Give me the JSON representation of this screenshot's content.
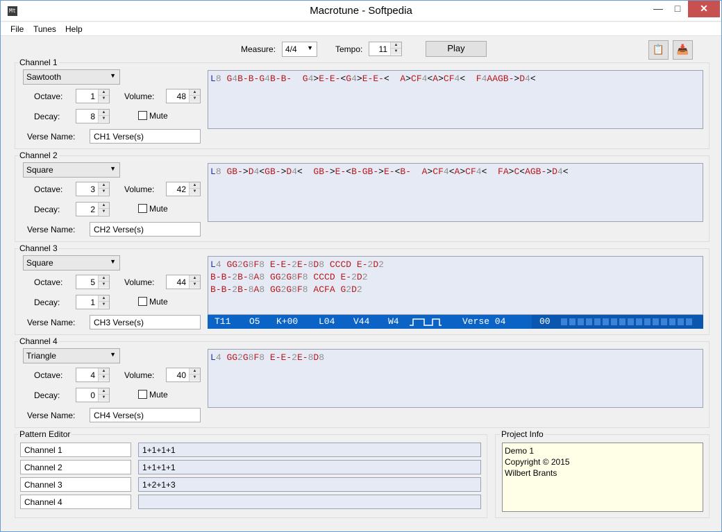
{
  "window": {
    "title": "Macrotune - Softpedia",
    "app_icon": "Mt"
  },
  "menu": [
    "File",
    "Tunes",
    "Help"
  ],
  "toolbar": {
    "measure_label": "Measure:",
    "measure_value": "4/4",
    "tempo_label": "Tempo:",
    "tempo_value": "11",
    "play_label": "Play"
  },
  "labels": {
    "octave": "Octave:",
    "volume": "Volume:",
    "decay": "Decay:",
    "mute": "Mute",
    "verse_name": "Verse Name:"
  },
  "channels": [
    {
      "title": "Channel 1",
      "wave": "Sawtooth",
      "octave": "1",
      "volume": "48",
      "decay": "8",
      "verse": "CH1 Verse(s)"
    },
    {
      "title": "Channel 2",
      "wave": "Square",
      "octave": "3",
      "volume": "42",
      "decay": "2",
      "verse": "CH2 Verse(s)"
    },
    {
      "title": "Channel 3",
      "wave": "Square",
      "octave": "5",
      "volume": "44",
      "decay": "1",
      "verse": "CH3 Verse(s)"
    },
    {
      "title": "Channel 4",
      "wave": "Triangle",
      "octave": "4",
      "volume": "40",
      "decay": "0",
      "verse": "CH4 Verse(s)"
    }
  ],
  "editors": {
    "ch1": [
      [
        [
          "L",
          "b"
        ],
        [
          "8",
          "g"
        ],
        [
          " ",
          "k"
        ],
        [
          "G",
          "r"
        ],
        [
          "4",
          "g"
        ],
        [
          "B",
          "r"
        ],
        [
          "-",
          "r"
        ],
        [
          "B",
          "r"
        ],
        [
          "-",
          "r"
        ],
        [
          "G",
          "r"
        ],
        [
          "4",
          "g"
        ],
        [
          "B",
          "r"
        ],
        [
          "-",
          "r"
        ],
        [
          "B",
          "r"
        ],
        [
          "-",
          "r"
        ],
        [
          "  ",
          "k"
        ],
        [
          "G",
          "r"
        ],
        [
          "4",
          "g"
        ],
        [
          ">",
          "k"
        ],
        [
          "E",
          "r"
        ],
        [
          "-",
          "r"
        ],
        [
          "E",
          "r"
        ],
        [
          "-",
          "r"
        ],
        [
          "<",
          "k"
        ],
        [
          "G",
          "r"
        ],
        [
          "4",
          "g"
        ],
        [
          ">",
          "k"
        ],
        [
          "E",
          "r"
        ],
        [
          "-",
          "r"
        ],
        [
          "E",
          "r"
        ],
        [
          "-",
          "r"
        ],
        [
          "<",
          "k"
        ],
        [
          "  ",
          "k"
        ],
        [
          "A",
          "r"
        ],
        [
          ">",
          "k"
        ],
        [
          "C",
          "r"
        ],
        [
          "F",
          "r"
        ],
        [
          "4",
          "g"
        ],
        [
          "<",
          "k"
        ],
        [
          "A",
          "r"
        ],
        [
          ">",
          "k"
        ],
        [
          "C",
          "r"
        ],
        [
          "F",
          "r"
        ],
        [
          "4",
          "g"
        ],
        [
          "<",
          "k"
        ],
        [
          "  ",
          "k"
        ],
        [
          "F",
          "r"
        ],
        [
          "4",
          "g"
        ],
        [
          "AAGB",
          "r"
        ],
        [
          "-",
          "r"
        ],
        [
          ">",
          "k"
        ],
        [
          "D",
          "r"
        ],
        [
          "4",
          "g"
        ],
        [
          "<",
          "k"
        ]
      ]
    ],
    "ch2": [
      [
        [
          "L",
          "b"
        ],
        [
          "8",
          "g"
        ],
        [
          " ",
          "k"
        ],
        [
          "G",
          "r"
        ],
        [
          "B",
          "r"
        ],
        [
          "-",
          "r"
        ],
        [
          ">",
          "k"
        ],
        [
          "D",
          "r"
        ],
        [
          "4",
          "g"
        ],
        [
          "<",
          "k"
        ],
        [
          "G",
          "r"
        ],
        [
          "B",
          "r"
        ],
        [
          "-",
          "r"
        ],
        [
          ">",
          "k"
        ],
        [
          "D",
          "r"
        ],
        [
          "4",
          "g"
        ],
        [
          "<",
          "k"
        ],
        [
          "  ",
          "k"
        ],
        [
          "G",
          "r"
        ],
        [
          "B",
          "r"
        ],
        [
          "-",
          "r"
        ],
        [
          ">",
          "k"
        ],
        [
          "E",
          "r"
        ],
        [
          "-",
          "r"
        ],
        [
          "<",
          "k"
        ],
        [
          "B",
          "r"
        ],
        [
          "-",
          "r"
        ],
        [
          "G",
          "r"
        ],
        [
          "B",
          "r"
        ],
        [
          "-",
          "r"
        ],
        [
          ">",
          "k"
        ],
        [
          "E",
          "r"
        ],
        [
          "-",
          "r"
        ],
        [
          "<",
          "k"
        ],
        [
          "B",
          "r"
        ],
        [
          "-",
          "r"
        ],
        [
          "  ",
          "k"
        ],
        [
          "A",
          "r"
        ],
        [
          ">",
          "k"
        ],
        [
          "C",
          "r"
        ],
        [
          "F",
          "r"
        ],
        [
          "4",
          "g"
        ],
        [
          "<",
          "k"
        ],
        [
          "A",
          "r"
        ],
        [
          ">",
          "k"
        ],
        [
          "C",
          "r"
        ],
        [
          "F",
          "r"
        ],
        [
          "4",
          "g"
        ],
        [
          "<",
          "k"
        ],
        [
          "  ",
          "k"
        ],
        [
          "F",
          "r"
        ],
        [
          "A",
          "r"
        ],
        [
          ">",
          "k"
        ],
        [
          "C",
          "r"
        ],
        [
          "<",
          "k"
        ],
        [
          "AGB",
          "r"
        ],
        [
          "-",
          "r"
        ],
        [
          ">",
          "k"
        ],
        [
          "D",
          "r"
        ],
        [
          "4",
          "g"
        ],
        [
          "<",
          "k"
        ]
      ]
    ],
    "ch3": [
      [
        [
          "L",
          "b"
        ],
        [
          "4",
          "g"
        ],
        [
          " ",
          "k"
        ],
        [
          "GG",
          "r"
        ],
        [
          "2",
          "g"
        ],
        [
          "G",
          "r"
        ],
        [
          "8",
          "g"
        ],
        [
          "F",
          "r"
        ],
        [
          "8",
          "g"
        ],
        [
          " ",
          "k"
        ],
        [
          "E",
          "r"
        ],
        [
          "-",
          "r"
        ],
        [
          "E",
          "r"
        ],
        [
          "-",
          "r"
        ],
        [
          "2",
          "g"
        ],
        [
          "E",
          "r"
        ],
        [
          "-",
          "r"
        ],
        [
          "8",
          "g"
        ],
        [
          "D",
          "r"
        ],
        [
          "8",
          "g"
        ],
        [
          " ",
          "k"
        ],
        [
          "CCCD",
          "r"
        ],
        [
          " ",
          "k"
        ],
        [
          "E",
          "r"
        ],
        [
          "-",
          "r"
        ],
        [
          "2",
          "g"
        ],
        [
          "D",
          "r"
        ],
        [
          "2",
          "g"
        ]
      ],
      [
        [
          "B",
          "r"
        ],
        [
          "-",
          "r"
        ],
        [
          "B",
          "r"
        ],
        [
          "-",
          "r"
        ],
        [
          "2",
          "g"
        ],
        [
          "B",
          "r"
        ],
        [
          "-",
          "r"
        ],
        [
          "8",
          "g"
        ],
        [
          "A",
          "r"
        ],
        [
          "8",
          "g"
        ],
        [
          " ",
          "k"
        ],
        [
          "GG",
          "r"
        ],
        [
          "2",
          "g"
        ],
        [
          "G",
          "r"
        ],
        [
          "8",
          "g"
        ],
        [
          "F",
          "r"
        ],
        [
          "8",
          "g"
        ],
        [
          " ",
          "k"
        ],
        [
          "CCCD",
          "r"
        ],
        [
          " ",
          "k"
        ],
        [
          "E",
          "r"
        ],
        [
          "-",
          "r"
        ],
        [
          "2",
          "g"
        ],
        [
          "D",
          "r"
        ],
        [
          "2",
          "g"
        ]
      ],
      [
        [
          "B",
          "r"
        ],
        [
          "-",
          "r"
        ],
        [
          "B",
          "r"
        ],
        [
          "-",
          "r"
        ],
        [
          "2",
          "g"
        ],
        [
          "B",
          "r"
        ],
        [
          "-",
          "r"
        ],
        [
          "8",
          "g"
        ],
        [
          "A",
          "r"
        ],
        [
          "8",
          "g"
        ],
        [
          " ",
          "k"
        ],
        [
          "GG",
          "r"
        ],
        [
          "2",
          "g"
        ],
        [
          "G",
          "r"
        ],
        [
          "8",
          "g"
        ],
        [
          "F",
          "r"
        ],
        [
          "8",
          "g"
        ],
        [
          " ",
          "k"
        ],
        [
          "ACFA",
          "r"
        ],
        [
          " ",
          "k"
        ],
        [
          "G",
          "r"
        ],
        [
          "2",
          "g"
        ],
        [
          "D",
          "r"
        ],
        [
          "2",
          "g"
        ]
      ]
    ],
    "ch4": [
      [
        [
          "L",
          "b"
        ],
        [
          "4",
          "g"
        ],
        [
          " ",
          "k"
        ],
        [
          "GG",
          "r"
        ],
        [
          "2",
          "g"
        ],
        [
          "G",
          "r"
        ],
        [
          "8",
          "g"
        ],
        [
          "F",
          "r"
        ],
        [
          "8",
          "g"
        ],
        [
          " ",
          "k"
        ],
        [
          "E",
          "r"
        ],
        [
          "-",
          "r"
        ],
        [
          "E",
          "r"
        ],
        [
          "-",
          "r"
        ],
        [
          "2",
          "g"
        ],
        [
          "E",
          "r"
        ],
        [
          "-",
          "r"
        ],
        [
          "8",
          "g"
        ],
        [
          "D",
          "r"
        ],
        [
          "8",
          "g"
        ]
      ]
    ]
  },
  "status": {
    "t": "T11",
    "o": "O5",
    "k": "K+00",
    "l": "L04",
    "v": "V44",
    "w": "W4",
    "verse": "Verse 04",
    "pos": "00"
  },
  "pattern_editor": {
    "title": "Pattern Editor",
    "rows": [
      {
        "name": "Channel 1",
        "pattern": "1+1+1+1"
      },
      {
        "name": "Channel 2",
        "pattern": "1+1+1+1"
      },
      {
        "name": "Channel 3",
        "pattern": "1+2+1+3"
      },
      {
        "name": "Channel 4",
        "pattern": ""
      }
    ]
  },
  "project_info": {
    "title": "Project Info",
    "lines": [
      "Demo 1",
      "Copyright © 2015",
      "Wilbert Brants"
    ]
  },
  "colors": {
    "note": "#b8181b",
    "length": "#2030a0",
    "number": "#909090",
    "status_bg": "#0c63c6"
  },
  "icons": {
    "clipboard_copy": "clipboard-icon",
    "clipboard_paste": "paste-icon"
  }
}
